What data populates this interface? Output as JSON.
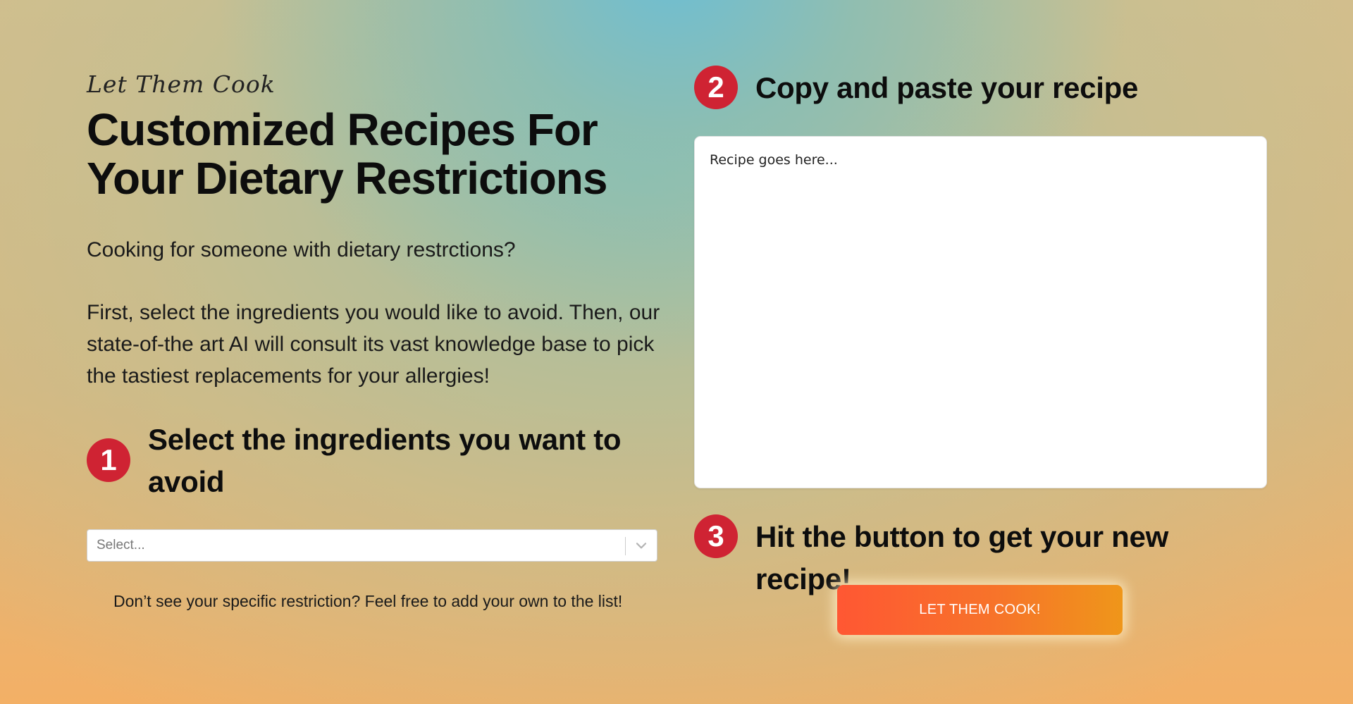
{
  "hero": {
    "brand": "Let Them Cook",
    "headline": "Customized Recipes For Your Dietary Restrictions",
    "lead": "Cooking for someone with dietary restrctions?",
    "description": "First, select the ingredients you would like to avoid. Then, our state-of-the art AI will consult its vast knowledge base to pick the tastiest replacements for your allergies!"
  },
  "step1": {
    "number": "1",
    "title": "Select the ingredients you want to avoid",
    "select_placeholder": "Select...",
    "hint": "Don’t see your specific restriction? Feel free to add your own to the list!"
  },
  "step2": {
    "number": "2",
    "title": "Copy and paste your recipe",
    "textarea_placeholder": "Recipe goes here..."
  },
  "step3": {
    "number": "3",
    "title": "Hit the button to get your new recipe!",
    "button_label": "LET THEM COOK!"
  },
  "colors": {
    "accent_badge": "#cf2333",
    "button_start": "#ff5733",
    "button_end": "#ef961a"
  },
  "icons": {
    "select_indicator": "chevron-down-icon"
  }
}
